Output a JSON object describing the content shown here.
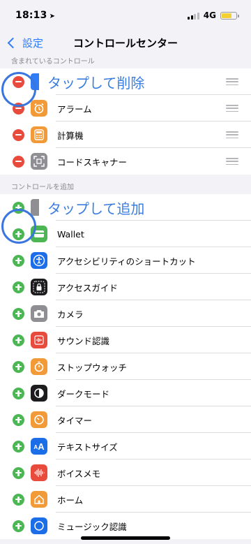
{
  "status": {
    "time": "18:13",
    "network": "4G"
  },
  "nav": {
    "back_label": "設定",
    "title": "コントロールセンター"
  },
  "included_header": "含まれているコントロール",
  "add_header": "コントロールを追加",
  "included_rows": [
    {
      "label": "タップして削除",
      "icon": "flashlight-icon",
      "color": "#2f7cf6"
    },
    {
      "label": "アラーム",
      "icon": "alarm-clock-icon",
      "color": "#f19a37"
    },
    {
      "label": "計算機",
      "icon": "calculator-icon",
      "color": "#f19a37"
    },
    {
      "label": "コードスキャナー",
      "icon": "qr-code-icon",
      "color": "#8e8e93"
    }
  ],
  "add_rows": [
    {
      "label": "タップして追加",
      "icon": "apple-tv-remote-icon",
      "color": "#8e8e93"
    },
    {
      "label": "Wallet",
      "icon": "wallet-icon",
      "color": "#4cb655"
    },
    {
      "label": "アクセシビリティのショートカット",
      "icon": "accessibility-icon",
      "color": "#1c6ee8"
    },
    {
      "label": "アクセスガイド",
      "icon": "lock-icon",
      "color": "#1c1c1e"
    },
    {
      "label": "カメラ",
      "icon": "camera-icon",
      "color": "#8e8e93"
    },
    {
      "label": "サウンド認識",
      "icon": "sound-recognition-icon",
      "color": "#e84a3c"
    },
    {
      "label": "ストップウォッチ",
      "icon": "stopwatch-icon",
      "color": "#f19a37"
    },
    {
      "label": "ダークモード",
      "icon": "dark-mode-icon",
      "color": "#1c1c1e"
    },
    {
      "label": "タイマー",
      "icon": "timer-icon",
      "color": "#f19a37"
    },
    {
      "label": "テキストサイズ",
      "icon": "text-size-icon",
      "color": "#1c6ee8"
    },
    {
      "label": "ボイスメモ",
      "icon": "voice-memo-icon",
      "color": "#e84a3c"
    },
    {
      "label": "ホーム",
      "icon": "home-icon",
      "color": "#f19a37"
    },
    {
      "label": "ミュージック認識",
      "icon": "music-recognition-icon",
      "color": "#1c6ee8"
    }
  ]
}
